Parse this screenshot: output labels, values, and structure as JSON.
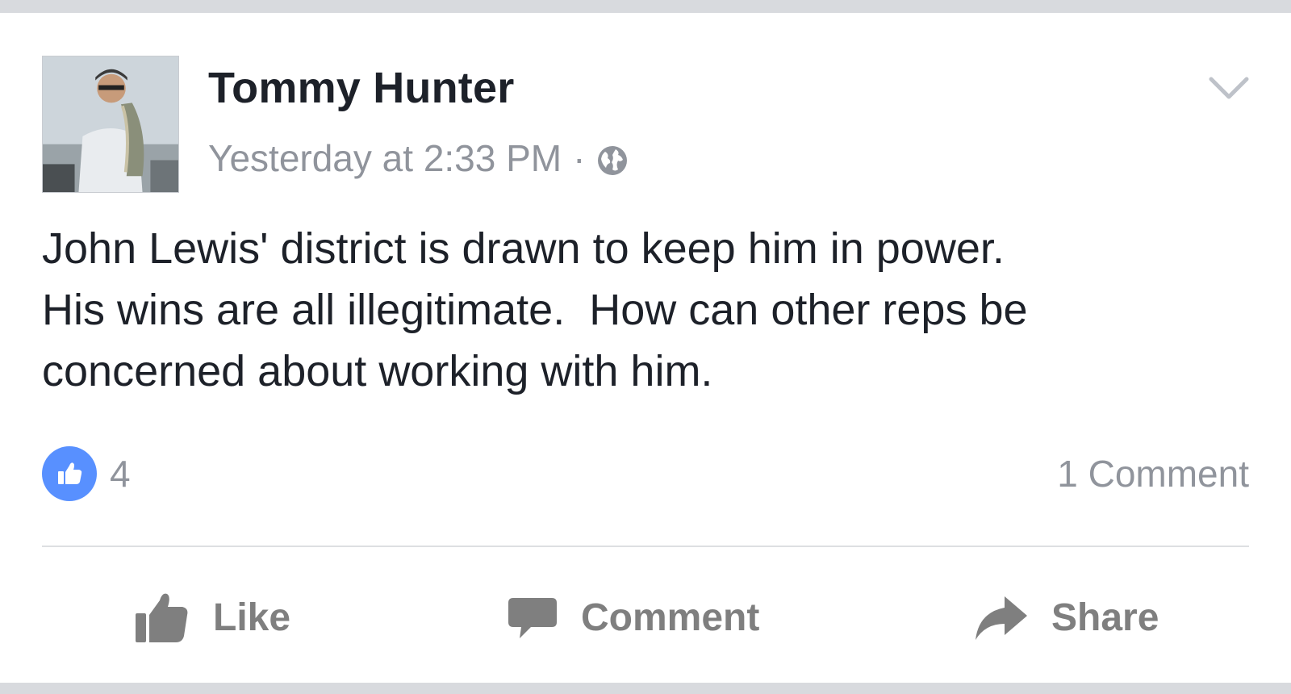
{
  "post": {
    "author": "Tommy Hunter",
    "timestamp": "Yesterday at 2:33 PM",
    "separator": "·",
    "privacy_icon": "globe-icon",
    "menu_icon": "chevron-down-icon",
    "text_lines": [
      "John Lewis' district is drawn to keep him in power.",
      "His wins are all illegitimate.  How can other reps be",
      "concerned about working with him."
    ]
  },
  "stats": {
    "like_icon": "like-badge-icon",
    "like_count": "4",
    "comments": "1 Comment"
  },
  "actions": {
    "like": {
      "label": "Like",
      "icon": "thumbs-up-icon"
    },
    "comment": {
      "label": "Comment",
      "icon": "speech-bubble-icon"
    },
    "share": {
      "label": "Share",
      "icon": "share-arrow-icon"
    }
  },
  "colors": {
    "like_blue": "#5890ff",
    "meta_gray": "#90949c",
    "action_gray": "#7f7f7f",
    "text": "#1d2129",
    "frame": "#d8dade"
  }
}
